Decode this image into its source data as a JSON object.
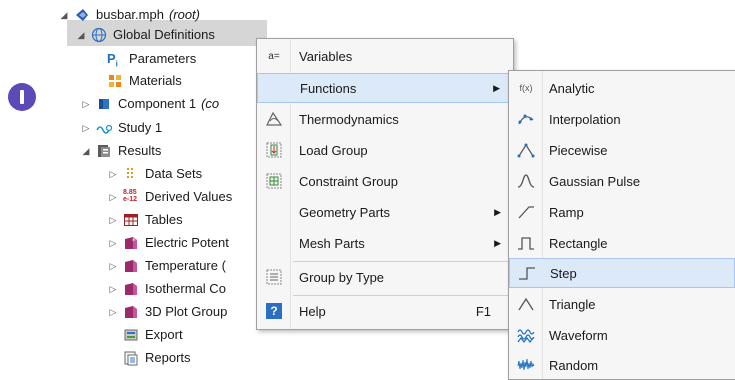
{
  "tree": {
    "root_label": "busbar.mph",
    "root_suffix": "(root)",
    "global_definitions": "Global Definitions",
    "parameters": "Parameters",
    "materials": "Materials",
    "component": "Component 1",
    "component_suffix": "(co",
    "study": "Study 1",
    "results": "Results",
    "data_sets": "Data Sets",
    "derived_values": "Derived Values",
    "tables": "Tables",
    "electric_potential": "Electric Potent",
    "temperature": "Temperature (",
    "isothermal": "Isothermal Co",
    "plot_group_3d": "3D Plot Group",
    "export": "Export",
    "reports": "Reports",
    "derived_values_icon_text": "8.85\ne-12"
  },
  "context_menu": {
    "variables": "Variables",
    "functions": "Functions",
    "thermodynamics": "Thermodynamics",
    "load_group": "Load Group",
    "constraint_group": "Constraint Group",
    "geometry_parts": "Geometry Parts",
    "mesh_parts": "Mesh Parts",
    "group_by_type": "Group by Type",
    "help": "Help",
    "help_shortcut": "F1",
    "variables_icon_text": "a=",
    "help_icon_text": "?"
  },
  "functions_submenu": {
    "analytic": "Analytic",
    "interpolation": "Interpolation",
    "piecewise": "Piecewise",
    "gaussian_pulse": "Gaussian Pulse",
    "ramp": "Ramp",
    "rectangle": "Rectangle",
    "step": "Step",
    "triangle": "Triangle",
    "waveform": "Waveform",
    "random": "Random",
    "analytic_icon_text": "f(x)"
  },
  "colors": {
    "highlight": "#dbe9f8",
    "accent_blue": "#1f6fc2",
    "badge_purple": "#5b4ab8"
  }
}
